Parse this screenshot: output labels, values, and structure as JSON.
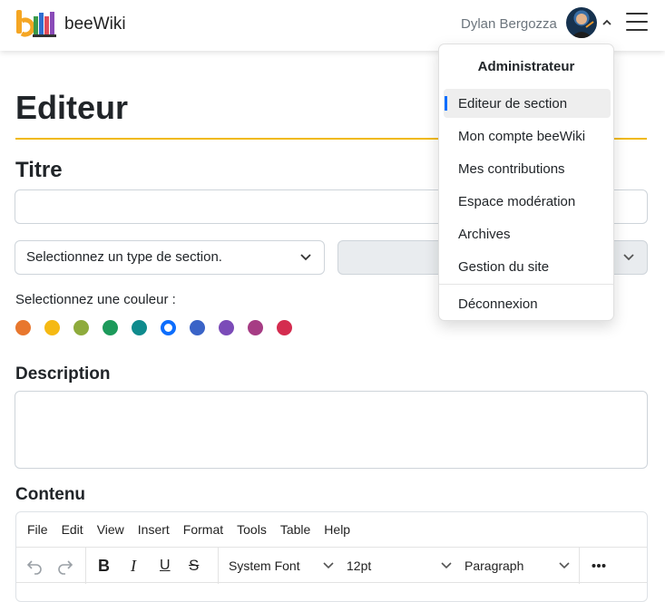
{
  "header": {
    "brand": "beeWiki",
    "user_name": "Dylan Bergozza"
  },
  "page": {
    "title": "Editeur",
    "titre_label": "Titre",
    "titre_value": "",
    "section_type_select": "Selectionnez un type de section.",
    "second_select": "",
    "color_label": "Selectionnez une couleur :",
    "colors": [
      "#e8772e",
      "#f5b913",
      "#8eab3c",
      "#1d9a5b",
      "#0f8b8d",
      "#0d6efd",
      "#3a63c7",
      "#7b4bb8",
      "#a63c84",
      "#d42c4f"
    ],
    "selected_color_index": 5,
    "description_label": "Description",
    "description_value": "",
    "contenu_label": "Contenu"
  },
  "editor": {
    "menu": [
      "File",
      "Edit",
      "View",
      "Insert",
      "Format",
      "Tools",
      "Table",
      "Help"
    ],
    "font_family": "System Font",
    "font_size": "12pt",
    "block_format": "Paragraph",
    "icons": [
      "undo-icon",
      "redo-icon",
      "bold-icon",
      "italic-icon",
      "underline-icon",
      "strikethrough-icon",
      "more-icon"
    ]
  },
  "dropdown": {
    "header": "Administrateur",
    "items": [
      {
        "label": "Editeur de section",
        "active": true
      },
      {
        "label": "Mon compte beeWiki",
        "active": false
      },
      {
        "label": "Mes contributions",
        "active": false
      },
      {
        "label": "Espace modération",
        "active": false
      },
      {
        "label": "Archives",
        "active": false
      },
      {
        "label": "Gestion du site",
        "active": false
      }
    ],
    "logout": "Déconnexion"
  }
}
